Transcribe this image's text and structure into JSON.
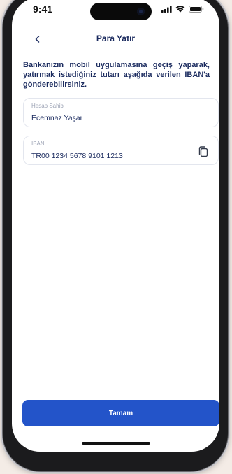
{
  "status_bar": {
    "time": "9:41"
  },
  "nav": {
    "title": "Para Yatır",
    "back_icon": "chevron-left-icon"
  },
  "info": {
    "text": "Bankanızın mobil uygulamasına geçiş yaparak, yatırmak istediğiniz tutarı aşağıda verilen IBAN'a gönderebilirsiniz."
  },
  "fields": {
    "account_holder": {
      "label": "Hesap Sahibi",
      "value": "Ecemnaz Yaşar"
    },
    "iban": {
      "label": "IBAN",
      "value": "TR00 1234 5678 9101 1213",
      "action_icon": "copy-icon"
    }
  },
  "actions": {
    "confirm_label": "Tamam"
  },
  "colors": {
    "primary": "#2354c9",
    "text_dark": "#1a2a5e",
    "label_gray": "#9aa1b3",
    "border": "#e3e6ee"
  }
}
